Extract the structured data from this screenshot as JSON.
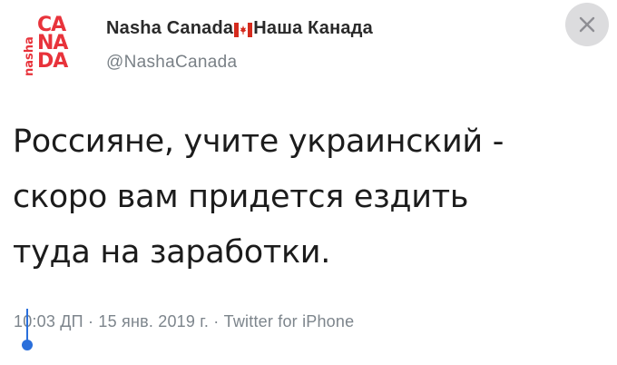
{
  "account": {
    "display_name_left": "Nasha Canada",
    "display_name_right": "Наша Канада",
    "handle": "@NashaCanada"
  },
  "logo": {
    "side_text": "nashа",
    "rows": [
      "CA",
      "NA",
      "DA"
    ],
    "color": "#e8333b"
  },
  "tweet": {
    "lines": [
      "Россияне, учите украинский -",
      "скоро вам придется ездить",
      "туда на заработки."
    ]
  },
  "meta": {
    "text": "10:03 ДП · 15 янв. 2019 г. · Twitter for iPhone"
  },
  "icons": {
    "close": "close-icon",
    "flag": "canada-flag-icon",
    "selection_handle": "text-selection-handle-icon"
  },
  "colors": {
    "logo_red": "#e8333b",
    "selection_blue": "#2a6fdb"
  }
}
